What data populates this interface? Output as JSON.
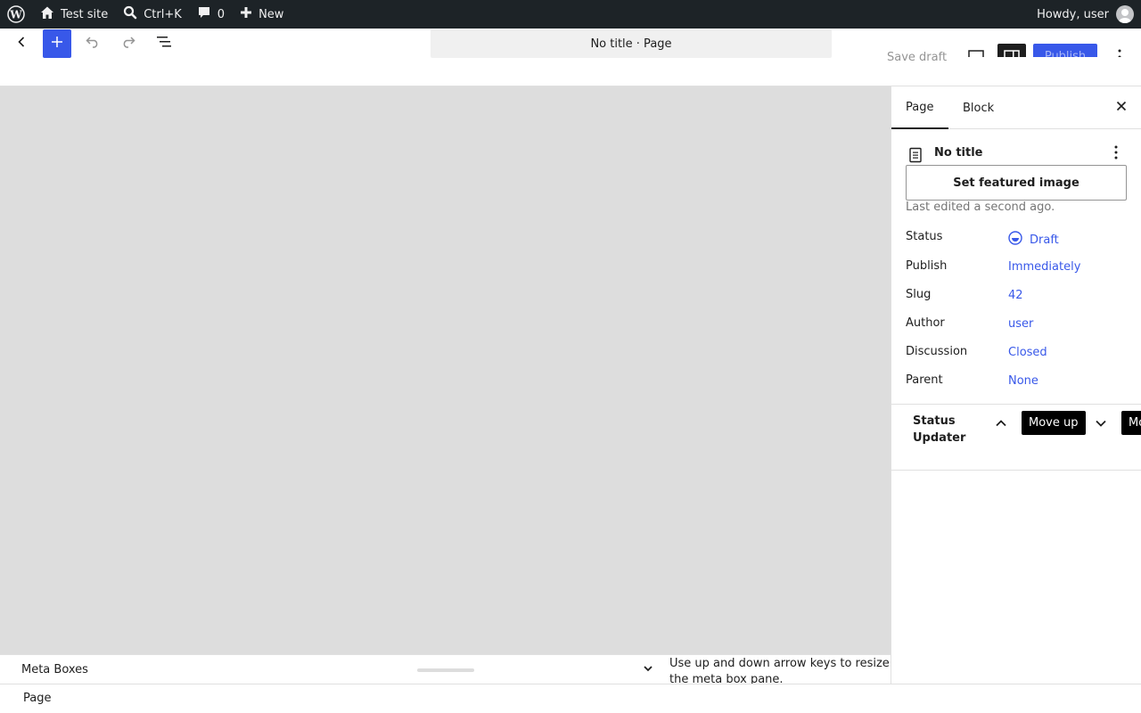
{
  "admin_bar": {
    "site_name": "Test site",
    "search_shortcut": "Ctrl+K",
    "comments_count": "0",
    "new_label": "New",
    "greeting": "Howdy, user"
  },
  "header": {
    "document_title": "No title · Page",
    "save_draft": "Save draft",
    "publish": "Publish"
  },
  "meta_pane": {
    "title": "Meta Boxes",
    "help": "Use up and down arrow keys to resize the meta box pane."
  },
  "footer": {
    "breadcrumb": "Page"
  },
  "sidebar": {
    "tabs": [
      "Page",
      "Block"
    ],
    "post_title": "No title",
    "featured_image_button": "Set featured image",
    "last_edited": "Last edited a second ago.",
    "rows": [
      {
        "label": "Status",
        "value": "Draft"
      },
      {
        "label": "Publish",
        "value": "Immediately"
      },
      {
        "label": "Slug",
        "value": "42"
      },
      {
        "label": "Author",
        "value": "user"
      },
      {
        "label": "Discussion",
        "value": "Closed"
      },
      {
        "label": "Parent",
        "value": "None"
      }
    ],
    "metabox": {
      "title": "Status Updater",
      "move_up_tooltip": "Move up",
      "move_down_tooltip": "Mo"
    }
  },
  "colors": {
    "admin_bar_bg": "#1d2327",
    "accent": "#3858e9",
    "canvas_bg": "#dddddd"
  }
}
